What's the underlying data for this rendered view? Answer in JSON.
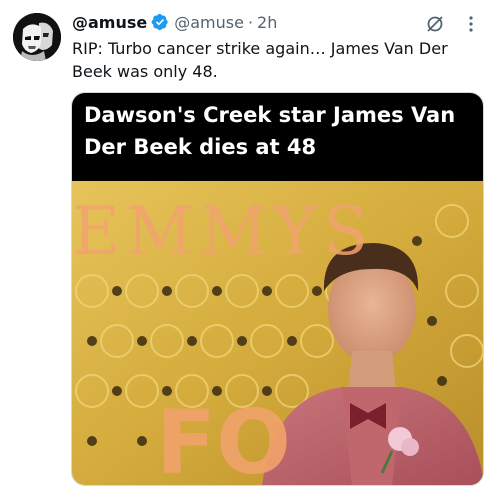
{
  "tweet": {
    "display_name": "@amuse",
    "handle": "@amuse",
    "separator": "·",
    "time": "2h",
    "text": "RIP: Turbo cancer strike again… James Van Der Beek was only 48.",
    "media": {
      "headline": "Dawson's Creek star James Van Der Beek dies at 48",
      "backdrop_text_top": "EMMYS",
      "backdrop_text_bottom": "FO"
    }
  },
  "icons": {
    "avatar": "stormtrooper-avatar",
    "verified": "verified-badge-icon",
    "grok": "grok-icon",
    "more": "more-icon"
  },
  "colors": {
    "verified_blue": "#1d9bf0",
    "secondary_text": "#536471",
    "primary_text": "#0f1419",
    "headline_bg": "#000000"
  }
}
